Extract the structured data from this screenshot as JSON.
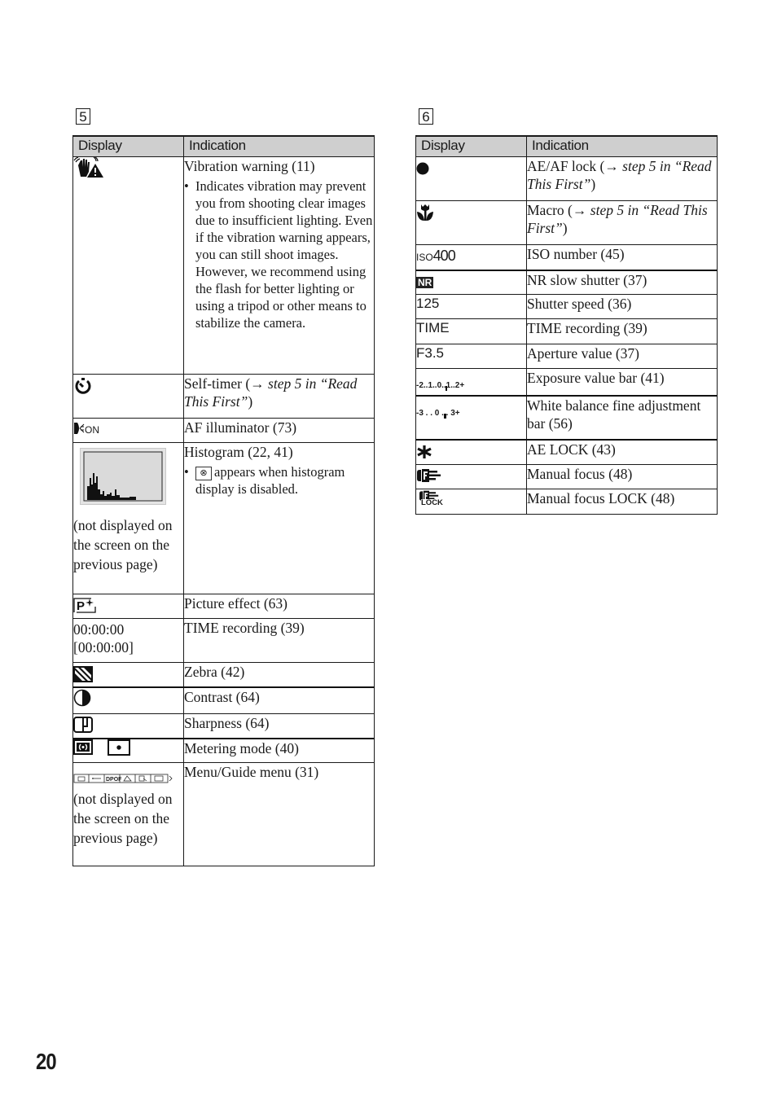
{
  "page_number": "20",
  "section5": {
    "label": "5",
    "headers": {
      "display": "Display",
      "indication": "Indication"
    },
    "rows": [
      {
        "icon": "vibration-warning-icon",
        "title": "Vibration warning (11)",
        "bullet": "Indicates vibration may prevent you from shooting clear images due to insufficient lighting. Even if the vibration warning appears, you can still shoot images. However, we recommend using the flash for better lighting or using a tripod or other means to stabilize the camera."
      },
      {
        "icon": "self-timer-icon",
        "title_plain": "Self-timer (",
        "arrow": "→",
        "title_italic": " step 5 in “Read This First”",
        "title_end": ")"
      },
      {
        "icon": "af-illuminator-icon",
        "icon_text": "ON",
        "title": "AF illuminator (73)"
      },
      {
        "icon": "histogram-icon",
        "display_note": "(not displayed on the screen on the previous page)",
        "title": "Histogram (22, 41)",
        "bullet_icon": "⊗",
        "bullet": "appears when histogram display is disabled."
      },
      {
        "icon": "picture-effect-icon",
        "icon_text": "P",
        "title": "Picture effect (63)"
      },
      {
        "display_text": "00:00:00 [00:00:00]",
        "title": "TIME recording (39)"
      },
      {
        "icon": "zebra-icon",
        "title": "Zebra (42)"
      },
      {
        "icon": "contrast-icon",
        "title": "Contrast (64)"
      },
      {
        "icon": "sharpness-icon",
        "title": "Sharpness (64)"
      },
      {
        "icon": "metering-mode-icon",
        "title": "Metering mode (40)"
      },
      {
        "icon": "menu-guide-icon",
        "menu_items": [
          "",
          "",
          "DPOF",
          "",
          "",
          ""
        ],
        "display_note": "(not displayed on the screen on the previous page)",
        "title": "Menu/Guide menu (31)"
      }
    ]
  },
  "section6": {
    "label": "6",
    "headers": {
      "display": "Display",
      "indication": "Indication"
    },
    "rows": [
      {
        "icon": "ae-af-lock-icon",
        "title_plain": "AE/AF lock (",
        "arrow": "→",
        "title_italic": " step 5 in “Read This First”",
        "title_end": ")"
      },
      {
        "icon": "macro-icon",
        "title_plain": "Macro (",
        "arrow": "→",
        "title_italic": " step 5 in “Read This First”",
        "title_end": ")"
      },
      {
        "icon": "iso-icon",
        "icon_small": "ISO",
        "icon_big": "400",
        "title": "ISO number (45)"
      },
      {
        "icon": "nr-icon",
        "icon_text": "NR",
        "title": "NR slow shutter (37)"
      },
      {
        "display_text": "125",
        "title": "Shutter speed (36)"
      },
      {
        "display_text": "TIME",
        "title": "TIME recording (39)"
      },
      {
        "display_text": "F3.5",
        "title": "Aperture value (37)"
      },
      {
        "icon": "exposure-value-bar-icon",
        "display_text": "-2..1..0..1..2+",
        "title": "Exposure value bar (41)"
      },
      {
        "icon": "white-balance-bar-icon",
        "display_text": "-3 . . 0 . . 3+",
        "title": "White balance fine adjustment bar (56)"
      },
      {
        "icon": "ae-lock-icon",
        "title": "AE LOCK (43)"
      },
      {
        "icon": "manual-focus-icon",
        "title": "Manual focus (48)"
      },
      {
        "icon": "manual-focus-lock-icon",
        "icon_text": "LOCK",
        "title": "Manual focus LOCK (48)"
      }
    ]
  }
}
